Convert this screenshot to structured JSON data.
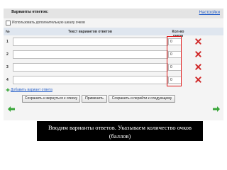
{
  "header": {
    "title": "Варианты ответов:",
    "settings_label": "Настройки"
  },
  "options": {
    "extra_scale_label": "Использовать дополнительную шкалу очков",
    "extra_scale_checked": false
  },
  "table": {
    "col_number": "№",
    "col_text": "Текст вариантов ответов",
    "col_points": "Кол-во очков",
    "rows": [
      {
        "number": "1",
        "text": "",
        "points": "0"
      },
      {
        "number": "2",
        "text": "",
        "points": "0"
      },
      {
        "number": "3",
        "text": "",
        "points": "0"
      },
      {
        "number": "4",
        "text": "",
        "points": "0"
      }
    ]
  },
  "add_option_label": "Добавить вариант ответа",
  "buttons": {
    "save_return": "Сохранить и вернуться к списку",
    "apply": "Применить",
    "save_next": "Сохранить и перейти к следующему"
  },
  "caption": {
    "line1": "Вводим варианты ответов. Указываем количество очков",
    "line2": "(баллов)"
  },
  "colors": {
    "highlight": "#e01818",
    "link": "#2a62c9",
    "nav_arrow": "#3aa63a",
    "delete": "#d02a2a"
  }
}
